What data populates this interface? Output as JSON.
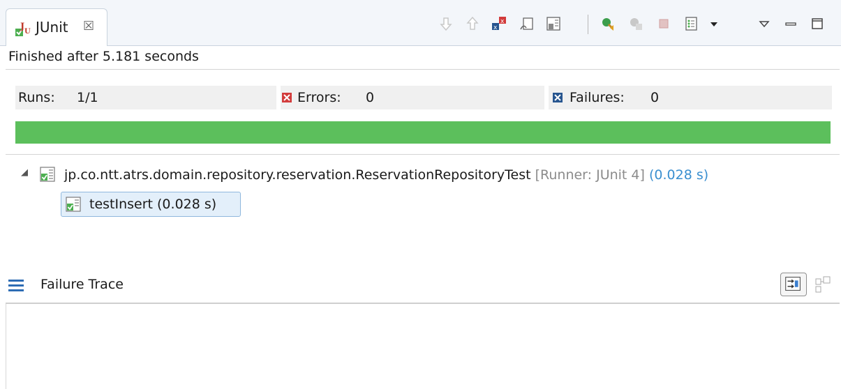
{
  "tab": {
    "title": "JUnit",
    "close_glyph": "☒",
    "icon": "junit-icon"
  },
  "toolbar": {
    "icons": [
      "next-failure-icon",
      "previous-failure-icon",
      "show-failures-only-icon",
      "scroll-lock-icon",
      "show-skipped-tests-icon",
      "rerun-test-icon",
      "rerun-failed-first-icon",
      "stop-icon",
      "test-run-history-icon",
      "history-dropdown-icon",
      "view-menu-icon",
      "minimize-icon",
      "maximize-icon"
    ]
  },
  "status": {
    "text": "Finished after 5.181 seconds"
  },
  "counters": {
    "runs_label": "Runs:",
    "runs_value": "1/1",
    "errors_label": "Errors:",
    "errors_value": "0",
    "failures_label": "Failures:",
    "failures_value": "0"
  },
  "progress": {
    "fraction": 1.0,
    "color": "#5cbf5c"
  },
  "tree": {
    "suite": {
      "name": "jp.co.ntt.atrs.domain.repository.reservation.ReservationRepositoryTest",
      "runner": "[Runner: JUnit 4]",
      "duration": "(0.028 s)"
    },
    "tests": [
      {
        "name": "testInsert (0.028 s)"
      }
    ]
  },
  "failure_trace": {
    "label": "Failure Trace"
  },
  "colors": {
    "accent_blue": "#3a8fd0",
    "error_red": "#d23b3b",
    "failure_blue": "#27558f"
  }
}
